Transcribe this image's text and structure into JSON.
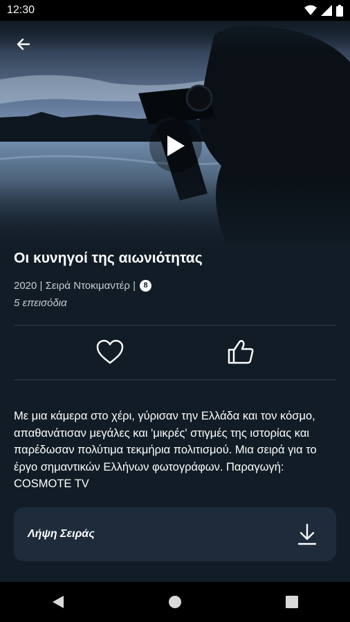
{
  "status_bar": {
    "time": "12:30"
  },
  "hero": {
    "back_icon": "arrow-left-icon",
    "play_icon": "play-icon"
  },
  "show": {
    "title": "Οι κυνηγοί της αιωνιότητας",
    "meta": "2020 | Σειρά Ντοκιμαντέρ |",
    "age_rating": "8",
    "episodes": "5 επεισόδια",
    "description": "Με μια κάμερα στο χέρι, γύρισαν την Ελλάδα και τον κόσμο, απαθανάτισαν μεγάλες και 'μικρές' στιγμές της ιστορίας και παρέδωσαν πολύτιμα τεκμήρια πολιτισμού. Μια σειρά για το έργο σημαντικών Ελλήνων φωτογράφων. Παραγωγή: COSMOTE TV"
  },
  "actions": {
    "favorite_icon": "heart-icon",
    "like_icon": "thumbs-up-icon"
  },
  "download": {
    "label": "Λήψη Σειράς",
    "icon": "download-icon"
  },
  "nav": {
    "back_icon": "nav-back-icon",
    "home_icon": "nav-home-icon",
    "recents_icon": "nav-recents-icon"
  }
}
